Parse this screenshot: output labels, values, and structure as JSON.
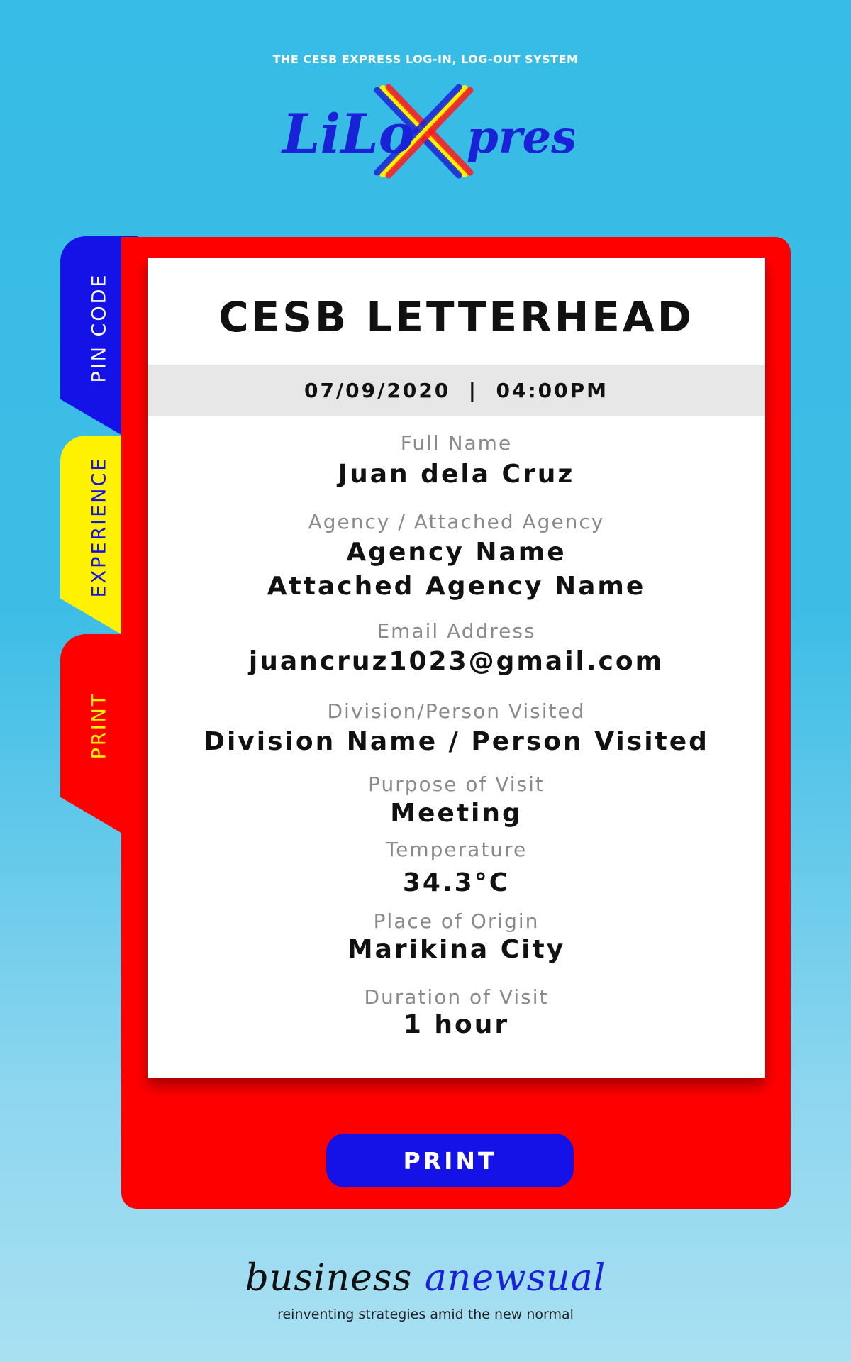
{
  "header": {
    "tagline": "THE CESB EXPRESS LOG-IN, LOG-OUT SYSTEM",
    "logo_text": "LiLoXpress"
  },
  "tabs": [
    {
      "label": "PIN CODE",
      "color": "#1512e8"
    },
    {
      "label": "EXPERIENCE",
      "color": "#fff200"
    },
    {
      "label": "PRINT",
      "color": "#ff0000"
    }
  ],
  "card": {
    "title": "CESB LETTERHEAD",
    "datetime": "07/09/2020  |  04:00PM",
    "fields": [
      {
        "label": "Full Name",
        "value": "Juan dela Cruz"
      },
      {
        "label": "Agency / Attached Agency",
        "value": "Agency Name",
        "value2": "Attached Agency Name"
      },
      {
        "label": "Email Address",
        "value": "juancruz1023@gmail.com"
      },
      {
        "label": "Division/Person Visited",
        "value": "Division Name / Person Visited"
      },
      {
        "label": "Purpose of Visit",
        "value": "Meeting"
      },
      {
        "label": "Temperature",
        "value": "34.3°C"
      },
      {
        "label": "Place of Origin",
        "value": "Marikina City"
      },
      {
        "label": "Duration of Visit",
        "value": "1 hour"
      }
    ]
  },
  "actions": {
    "print_label": "PRINT"
  },
  "footer": {
    "brand_part1": "business ",
    "brand_part2": "anewsual",
    "tagline": "reinventing strategies amid the new normal"
  },
  "colors": {
    "accent_blue": "#1512e8",
    "accent_red": "#ff0000",
    "accent_yellow": "#fff200",
    "background": "#36bce6"
  }
}
